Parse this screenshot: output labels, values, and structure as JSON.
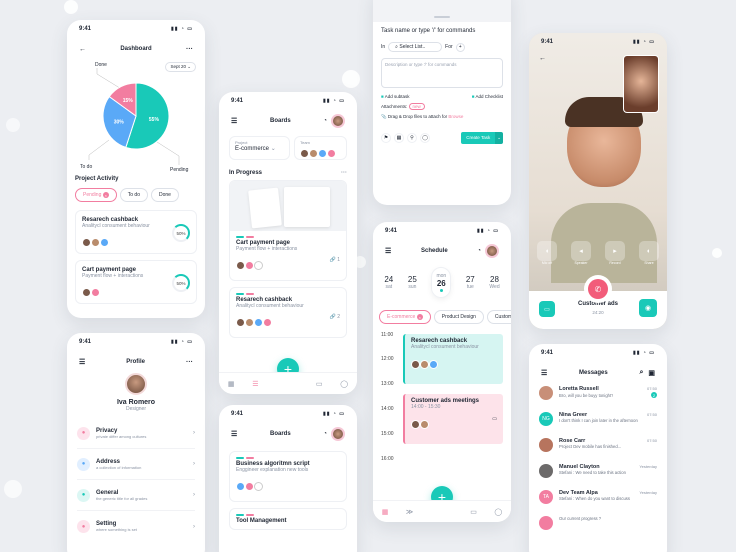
{
  "status_time": "9:41",
  "dashboard": {
    "title": "Dashboard",
    "date_filter": "Sept 20",
    "chart_labels": {
      "done": "Done",
      "todo": "To do",
      "pending": "Pending"
    },
    "chart_data": {
      "type": "pie",
      "categories": [
        "Done",
        "To do",
        "Pending"
      ],
      "values": [
        55,
        30,
        15
      ],
      "colors": [
        "#19c9b8",
        "#5aa9f7",
        "#f27da0"
      ]
    },
    "section": "Project Activity",
    "filters": [
      {
        "label": "Pending"
      },
      {
        "label": "To do"
      },
      {
        "label": "Done"
      }
    ],
    "tasks": [
      {
        "title": "Resarech cashback",
        "subtitle": "Analitycl consument behaviour",
        "progress": "50%"
      },
      {
        "title": "Cart payment page",
        "subtitle": "Payment flow + interactions",
        "progress": "50%"
      }
    ]
  },
  "profile": {
    "title": "Profile",
    "name": "Iva Romero",
    "role": "Designer",
    "items": [
      {
        "label": "Privacy",
        "sub": "private differ among cultures",
        "color": "#f27da0"
      },
      {
        "label": "Address",
        "sub": "a collection of information",
        "color": "#5aa9f7"
      },
      {
        "label": "General",
        "sub": "the generic title for all grades",
        "color": "#19c9b8"
      },
      {
        "label": "Setting",
        "sub": "where something is set",
        "color": "#f27da0"
      }
    ]
  },
  "boards": {
    "title": "Boards",
    "project_label": "Project",
    "project_value": "E-commerce",
    "team_label": "Team",
    "section": "In Progress",
    "cards": [
      {
        "title": "Cart payment page",
        "subtitle": "Payment flow + interactions",
        "comments": "1"
      },
      {
        "title": "Resarech cashback",
        "subtitle": "Analitycl consument behaviour",
        "comments": "2"
      }
    ]
  },
  "boards2": {
    "title": "Boards",
    "cards": [
      {
        "title": "Business algoritmn script",
        "subtitle": "Enggineer explanation new tools"
      },
      {
        "title": "Tool Management",
        "subtitle": ""
      }
    ]
  },
  "task_form": {
    "header": "Task name or type '/' for commands",
    "in_label": "In",
    "select_list": "Select List..",
    "for_label": "For",
    "description_placeholder": "Description or type '/' for commands",
    "add_subtask": "Add subtask",
    "add_checklist": "Add Checklist",
    "attachments": "Attachments:",
    "attachment_tag": "new",
    "drag_drop": "Drag & Drop files to attach for",
    "browse": "Browse",
    "create_button": "Create Task"
  },
  "schedule": {
    "title": "Schedule",
    "days": [
      {
        "num": "24",
        "day": "sat"
      },
      {
        "num": "25",
        "day": "sun"
      },
      {
        "num": "26",
        "day": "mon"
      },
      {
        "num": "27",
        "day": "tue"
      },
      {
        "num": "28",
        "day": "Wed"
      }
    ],
    "filters": [
      {
        "label": "E-commerce"
      },
      {
        "label": "Product Design"
      },
      {
        "label": "Custom"
      }
    ],
    "times": [
      "11:00",
      "12:00",
      "13:00",
      "14:00",
      "15:00",
      "16:00"
    ],
    "events": [
      {
        "title": "Resarech cashback",
        "sub": "Analitycl consument behaviour"
      },
      {
        "title": "Customer ads meetings",
        "sub": "14:00 - 15:30"
      }
    ]
  },
  "call": {
    "controls": [
      {
        "label": "Mic off"
      },
      {
        "label": "Speaker"
      },
      {
        "label": "Record"
      },
      {
        "label": "Share"
      }
    ],
    "caller": "Customer ads",
    "duration": "24:20"
  },
  "messages": {
    "title": "Messages",
    "items": [
      {
        "name": "Loretta Russell",
        "preview": "Bro, will you be buyy tonight?",
        "time": "07:50",
        "badge": "2",
        "avatar_color": "#c88f78"
      },
      {
        "name": "Nina Greer",
        "preview": "I don't think I can join later in the afternoon",
        "time": "07:50",
        "initials": "NG",
        "avatar_color": "#19c9b8"
      },
      {
        "name": "Rose Carr",
        "preview": "Project Dev mobile has finished...",
        "time": "07:50",
        "avatar_color": "#b7745e"
      },
      {
        "name": "Manuel Clayton",
        "preview": "Stefani : We need to take this action",
        "time": "Yesterday",
        "avatar_color": "#6c6a6a"
      },
      {
        "name": "Dev Team Alpa",
        "preview": "Stefani : When do you want to discuss",
        "time": "Yesterday",
        "initials": "TA",
        "avatar_color": "#f27da0"
      },
      {
        "name": "",
        "preview": "Our current progress ?",
        "time": "",
        "avatar_color": "#f27da0"
      }
    ]
  }
}
